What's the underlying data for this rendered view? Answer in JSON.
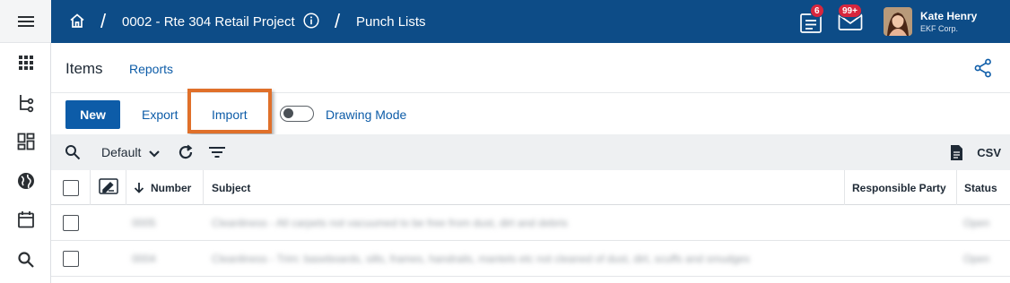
{
  "topbar": {
    "project": "0002 - Rte 304 Retail Project",
    "page": "Punch Lists",
    "separator": "/",
    "notifications_badge": "6",
    "mail_badge": "99+",
    "user_name": "Kate Henry",
    "user_company": "EKF Corp."
  },
  "title_row": {
    "title": "Items",
    "reports_link": "Reports"
  },
  "actions": {
    "new_label": "New",
    "export_label": "Export",
    "import_label": "Import",
    "drawing_mode_label": "Drawing Mode"
  },
  "grid_toolbar": {
    "view": "Default",
    "csv_label": "CSV"
  },
  "table": {
    "columns": {
      "number": "Number",
      "subject": "Subject",
      "responsible_party": "Responsible Party",
      "status": "Status"
    },
    "rows": [
      {
        "number": "0005",
        "subject": "Cleanliness - All carpets not vacuumed to be free from dust, dirt and debris",
        "responsible_party": "",
        "status": "Open"
      },
      {
        "number": "0004",
        "subject": "Cleanliness - Trim: baseboards, sills, frames, handrails, mantels etc not cleaned of dust, dirt, scuffs and smudges",
        "responsible_party": "",
        "status": "Open"
      }
    ]
  },
  "colors": {
    "header_bg": "#0d4c87",
    "accent": "#0d5ca8",
    "highlight": "#e0702a",
    "badge": "#d7263d"
  }
}
